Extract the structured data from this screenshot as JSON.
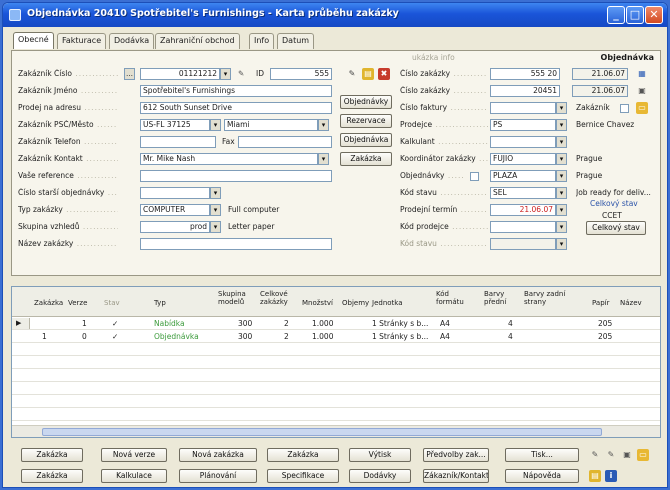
{
  "window": {
    "title": "Objednávka 20410 Spotřebitel's Furnishings - Karta průběhu zakázky"
  },
  "tabs": [
    "Obecné",
    "Fakturace",
    "Dodávka",
    "Zahraniční obchod",
    "Info",
    "Datum"
  ],
  "header": {
    "doc_type": "Objednávka",
    "faded_label": "ukázka info"
  },
  "left_fields": [
    {
      "label": "Zakázník Číslo",
      "value": "01121212",
      "extra_label": "ID",
      "extra_value": "555"
    },
    {
      "label": "Zakázník Jméno",
      "value": "Spotřebitel's Furnishings"
    },
    {
      "label": "Prodej na adresu",
      "value": "612 South Sunset Drive"
    },
    {
      "label": "Zakázník PSČ/Město",
      "value": "US-FL 37125",
      "value2": "Miami"
    },
    {
      "label": "Zakázník Telefon",
      "value": "",
      "fax_label": "Fax",
      "fax_value": ""
    },
    {
      "label": "Zakázník Kontakt",
      "value": "Mr. Mike Nash"
    },
    {
      "label": "Vaše reference",
      "value": ""
    },
    {
      "label": "Číslo starší objednávky",
      "value": ""
    },
    {
      "label": "Typ zakázky",
      "value": "COMPUTER",
      "side": "Full computer"
    },
    {
      "label": "Skupina vzhledů",
      "value": "prod",
      "side": "Letter paper"
    },
    {
      "label": "Název zakázky",
      "value": ""
    }
  ],
  "mid_buttons": [
    "Objednávky",
    "Rezervace",
    "Objednávka",
    "Zakázka"
  ],
  "right_fields": [
    {
      "label": "Číslo zakázky",
      "value": "555 20",
      "value2": "21.06.07"
    },
    {
      "label": "Číslo zakázky",
      "value": "20451",
      "value2": "21.06.07"
    },
    {
      "label": "Číslo faktury",
      "value": "",
      "side": "Zakázník"
    },
    {
      "label": "Prodejce",
      "value": "PS",
      "side": "Bernice Chavez"
    },
    {
      "label": "Kalkulant",
      "value": ""
    },
    {
      "label": "Koordinátor zakázky",
      "value": "FUJIO",
      "side": "Prague"
    },
    {
      "label": "Objednávky",
      "value": "PLAZA",
      "side": "Prague"
    },
    {
      "label": "Kód stavu",
      "value": "SEL",
      "side": "Job ready for deliv..."
    },
    {
      "label": "Prodejní termín",
      "value": "21.06.07",
      "side": "Celkový stav",
      "side2": "CCET"
    },
    {
      "label": "Kód prodejce",
      "value": "",
      "side": "Celkový stav",
      "side_button": "Celkový stav"
    },
    {
      "label": "Kód stavu",
      "value": ""
    }
  ],
  "lines_table": {
    "columns": [
      "Zakázka",
      "Verze",
      "Stav",
      "Typ",
      "Skupina modelů",
      "Celkové zakázky",
      "Množství",
      "Objemy",
      "Jednotka",
      "Kód formátu",
      "Barvy přední",
      "Barvy zadní strany",
      "Papír",
      "Název"
    ],
    "rows": [
      {
        "zakazka": "",
        "verze": "1",
        "stav": "✓",
        "typ": "Nabídka",
        "skupina": "300",
        "celkove": "2",
        "mnozstvi": "1.000",
        "objemy": "",
        "jednotka": "1 Stránky s b...",
        "kod": "A4",
        "barvy": "4",
        "papir": "205"
      },
      {
        "zakazka": "1",
        "verze": "0",
        "stav": "✓",
        "typ": "Objednávka",
        "skupina": "300",
        "celkove": "2",
        "mnozstvi": "1.000",
        "objemy": "",
        "jednotka": "1 Stránky s b...",
        "kod": "A4",
        "barvy": "4",
        "papir": "205"
      }
    ]
  },
  "footer": {
    "row1": [
      "Zakázka",
      "Nová verze",
      "Nová zakázka",
      "Zakázka",
      "Výtisk",
      "Předvolby zak...",
      "Tisk..."
    ],
    "row2": [
      "Zakázka",
      "Kalkulace",
      "Plánování",
      "Specifikace",
      "Dodávky",
      "Zákazník/Kontakt",
      "Nápověda"
    ]
  },
  "colors": {
    "title_bar": "#1a55d9",
    "accent_green": "#3c9b3c",
    "red_value": "#cc2020"
  }
}
